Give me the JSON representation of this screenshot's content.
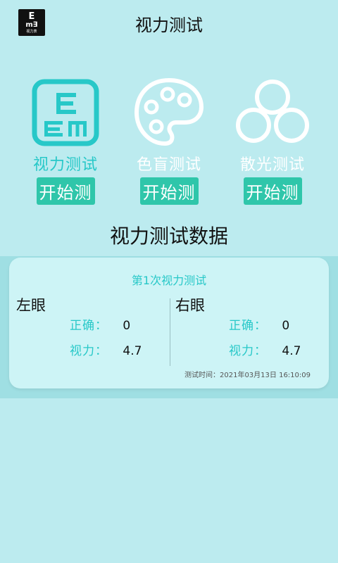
{
  "header": {
    "title": "视力测试",
    "logo": {
      "line1": "E",
      "line2": "m∃",
      "line3": "视力表"
    }
  },
  "tests": [
    {
      "label": "视力测试",
      "button": "开始测",
      "icon": "e-chart-icon"
    },
    {
      "label": "色盲测试",
      "button": "开始测",
      "icon": "palette-icon"
    },
    {
      "label": "散光测试",
      "button": "开始测",
      "icon": "rings-icon"
    }
  ],
  "section_title": "视力测试数据",
  "records": [
    {
      "title": "第1次视力测试",
      "left": {
        "name": "左眼",
        "correct_label": "正确：",
        "correct": "0",
        "vision_label": "视力：",
        "vision": "4.7"
      },
      "right": {
        "name": "右眼",
        "correct_label": "正确：",
        "correct": "0",
        "vision_label": "视力：",
        "vision": "4.7"
      },
      "time": "测试时间：2021年03月13日 16:10:09"
    }
  ],
  "colors": {
    "background": "#bcebef",
    "accent": "#27c8c8",
    "button": "#2fc6aa",
    "card": "#cdf4f6"
  }
}
